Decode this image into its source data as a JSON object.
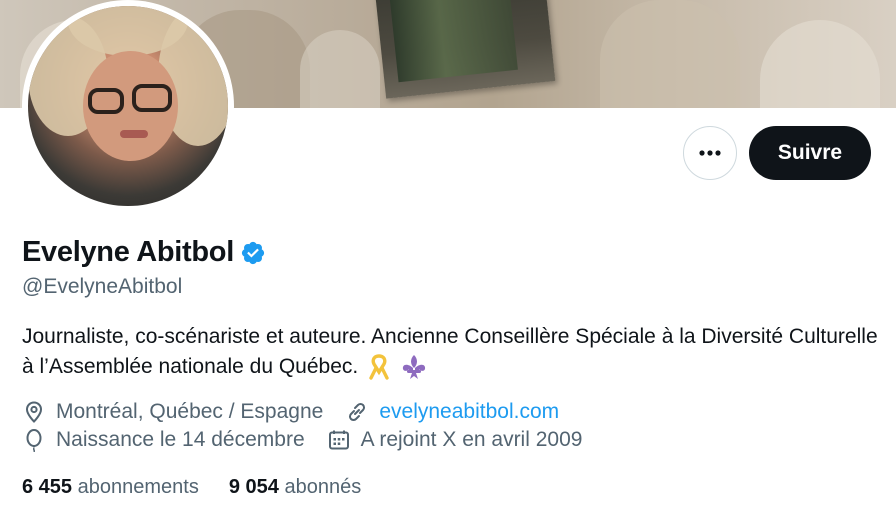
{
  "profile": {
    "name": "Evelyne Abitbol",
    "handle": "@EvelyneAbitbol",
    "bio": "Journaliste, co-scénariste et auteure. Ancienne Conseillère Spéciale à la Diversité Culturelle à l’Assemblée nationale du Québec.",
    "bio_emojis": [
      "yellow-ribbon-icon",
      "fleur-de-lis-icon"
    ],
    "location": "Montréal, Québec / Espagne",
    "website": "evelyneabitbol.com",
    "birthday": "Naissance le 14 décembre",
    "joined": "A rejoint X en avril 2009"
  },
  "actions": {
    "more_label": "•••",
    "follow_label": "Suivre"
  },
  "stats": {
    "following_count": "6 455",
    "following_label": "abonnements",
    "followers_count": "9 054",
    "followers_label": "abonnés"
  },
  "colors": {
    "accent": "#1d9bf0",
    "text": "#0f1419",
    "muted": "#536471",
    "button_dark": "#0f1419"
  }
}
